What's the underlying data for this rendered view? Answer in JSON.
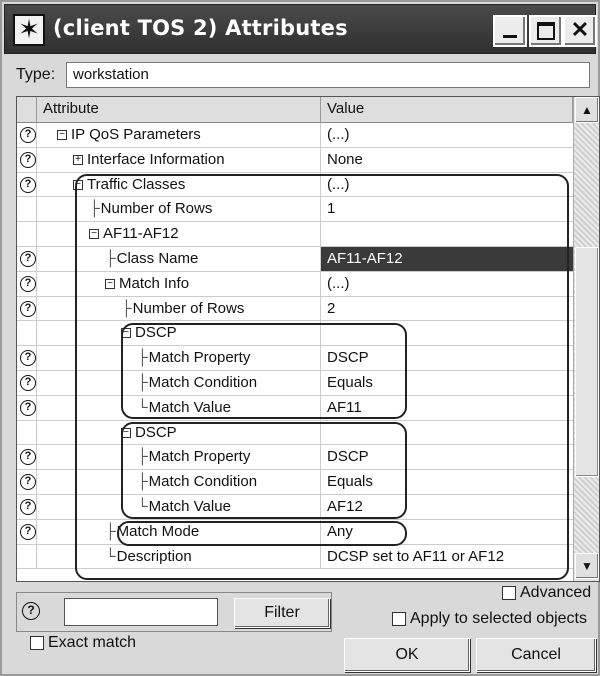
{
  "window": {
    "title": "(client TOS 2) Attributes",
    "icons": {
      "app": "star-icon",
      "minimize": "minimize-icon",
      "maximize": "maximize-icon",
      "close": "close-icon"
    }
  },
  "type_row": {
    "label": "Type:",
    "value": "workstation"
  },
  "table": {
    "headers": {
      "attribute": "Attribute",
      "value": "Value"
    },
    "rows": [
      {
        "q": true,
        "indent": 0,
        "prefix": "minus",
        "attr": "IP QoS Parameters",
        "value": "(...)"
      },
      {
        "q": true,
        "indent": 1,
        "prefix": "plus",
        "attr": "Interface Information",
        "value": "None"
      },
      {
        "q": true,
        "indent": 1,
        "prefix": "minus",
        "attr": "Traffic Classes",
        "value": "(...)"
      },
      {
        "q": false,
        "indent": 2,
        "prefix": "branch",
        "attr": "Number of Rows",
        "value": "1"
      },
      {
        "q": false,
        "indent": 2,
        "prefix": "minus",
        "attr": "AF11-AF12",
        "value": ""
      },
      {
        "q": true,
        "indent": 3,
        "prefix": "branch",
        "attr": "Class Name",
        "value": "AF11-AF12",
        "selected": true
      },
      {
        "q": true,
        "indent": 3,
        "prefix": "minus",
        "attr": "Match Info",
        "value": "(...)"
      },
      {
        "q": true,
        "indent": 4,
        "prefix": "branch",
        "attr": "Number of Rows",
        "value": "2"
      },
      {
        "q": false,
        "indent": 4,
        "prefix": "minus",
        "attr": "DSCP",
        "value": ""
      },
      {
        "q": true,
        "indent": 5,
        "prefix": "branch",
        "attr": "Match Property",
        "value": "DSCP"
      },
      {
        "q": true,
        "indent": 5,
        "prefix": "branch",
        "attr": "Match Condition",
        "value": "Equals"
      },
      {
        "q": true,
        "indent": 5,
        "prefix": "last",
        "attr": "Match Value",
        "value": "AF11"
      },
      {
        "q": false,
        "indent": 4,
        "prefix": "minus",
        "attr": "DSCP",
        "value": ""
      },
      {
        "q": true,
        "indent": 5,
        "prefix": "branch",
        "attr": "Match Property",
        "value": "DSCP"
      },
      {
        "q": true,
        "indent": 5,
        "prefix": "branch",
        "attr": "Match Condition",
        "value": "Equals"
      },
      {
        "q": true,
        "indent": 5,
        "prefix": "last",
        "attr": "Match Value",
        "value": "AF12"
      },
      {
        "q": true,
        "indent": 3,
        "prefix": "branch",
        "attr": "Match Mode",
        "value": "Any"
      },
      {
        "q": false,
        "indent": 3,
        "prefix": "last",
        "attr": "Description",
        "value": "DCSP set to AF11 or AF12"
      }
    ]
  },
  "bottom": {
    "filter_label": "Filter",
    "filter_value": "",
    "exact_match": "Exact match",
    "advanced": "Advanced",
    "apply_selected": "Apply to selected objects",
    "ok": "OK",
    "cancel": "Cancel"
  }
}
